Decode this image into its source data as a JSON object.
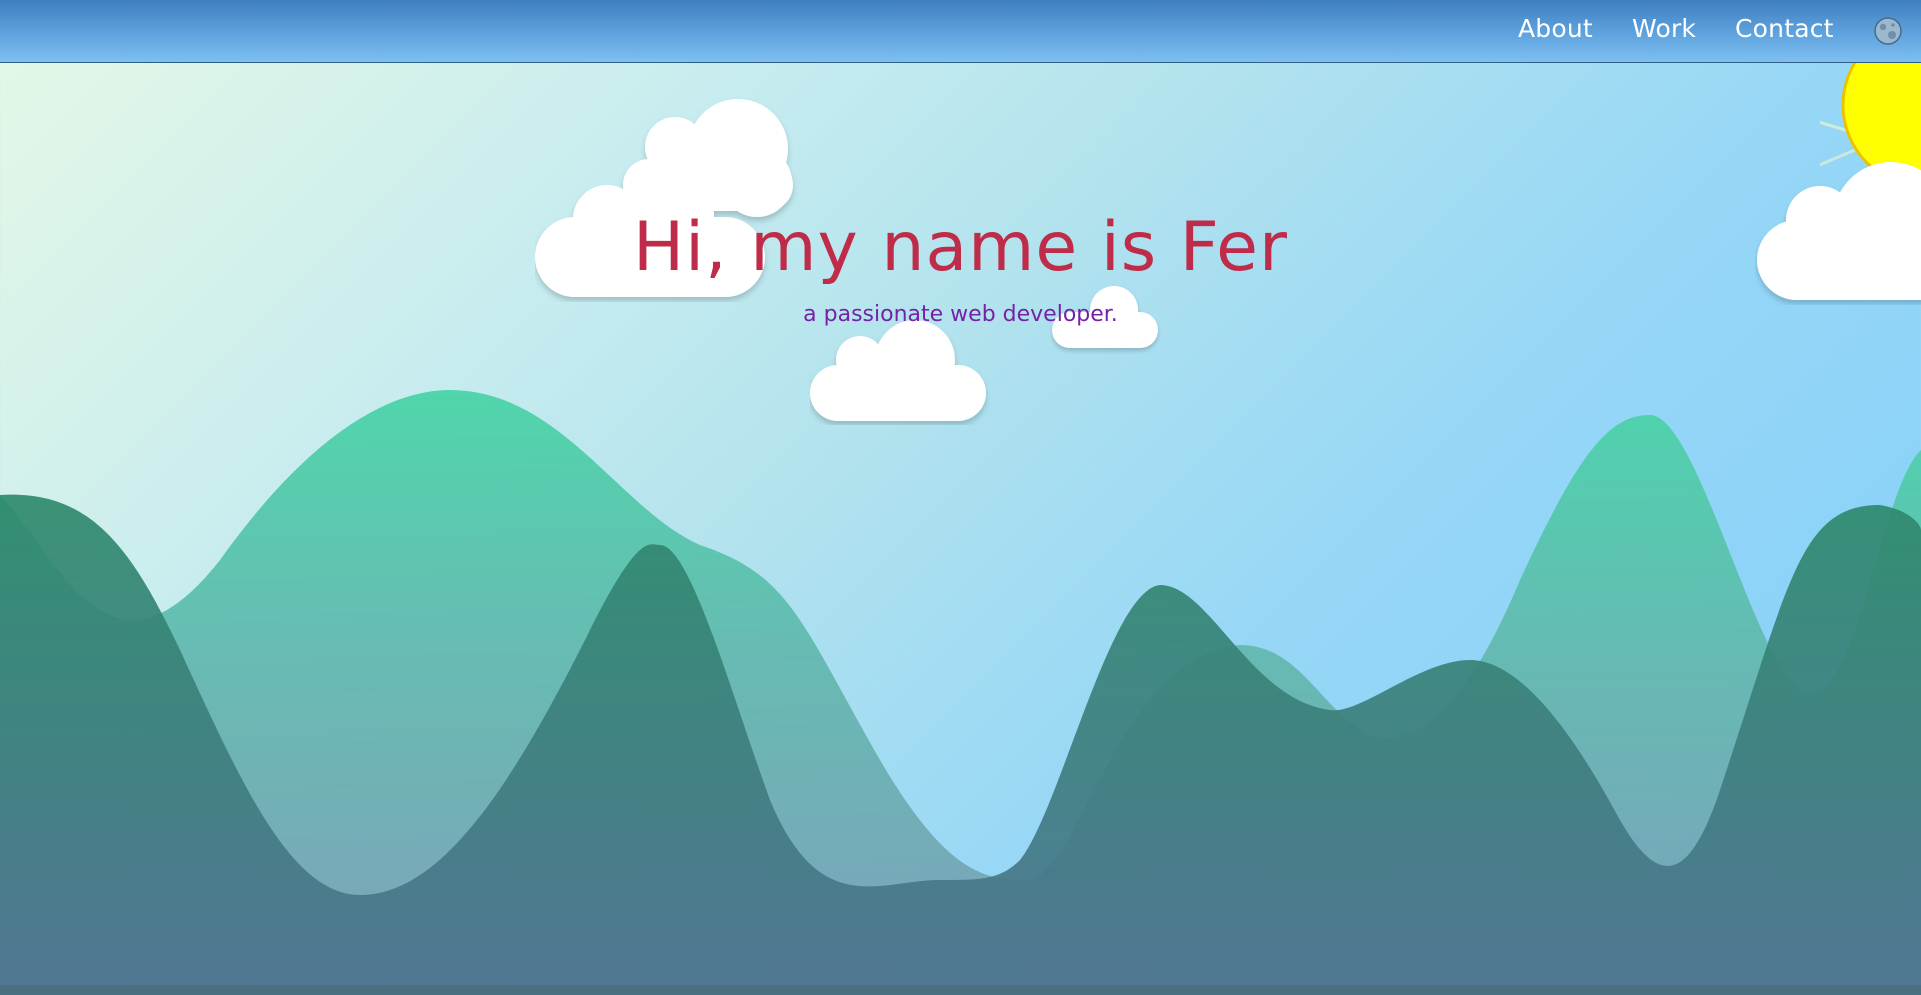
{
  "nav": {
    "items": [
      {
        "label": "About"
      },
      {
        "label": "Work"
      },
      {
        "label": "Contact"
      }
    ],
    "theme_toggle_icon": "moon-globe-icon"
  },
  "hero": {
    "title": "Hi, my name is Fer",
    "subtitle": "a passionate web developer."
  },
  "colors": {
    "title": "#be2c49",
    "subtitle": "#7423a6",
    "nav_bar": "#5ea3de",
    "sun": "#ffff00",
    "mountain_light": "#4ad4a8",
    "mountain_dark": "#2e8a6c"
  }
}
